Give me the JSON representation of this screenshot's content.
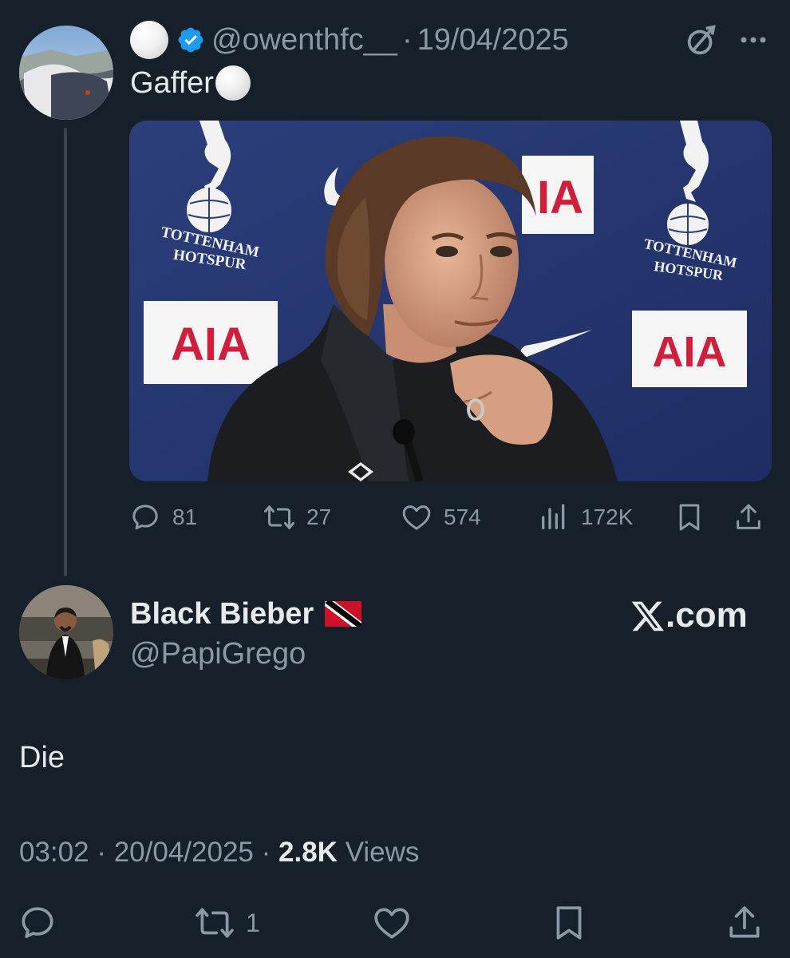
{
  "parent_tweet": {
    "name_icon": "white-circle-emoji",
    "verified_icon": "verified-badge-icon",
    "handle": "@owenthfc__",
    "separator": "·",
    "date": "19/04/2025",
    "text": "Gaffer",
    "text_emoji": "white-circle-emoji",
    "media": {
      "signage": {
        "club_line1": "TOTTENHAM",
        "club_line2": "HOTSPUR",
        "sponsor": "AIA",
        "sponsor_partial": "IA"
      }
    },
    "actions": {
      "replies": "81",
      "reposts": "27",
      "likes": "574",
      "views": "172K"
    }
  },
  "reply_tweet": {
    "display_name": "Black Bieber",
    "flag": "trinidad-and-tobago-flag",
    "handle": "@PapiGrego",
    "watermark": ".com",
    "text": "Die",
    "meta": {
      "time": "03:02",
      "sep1": "·",
      "date": "20/04/2025",
      "sep2": "·",
      "views_count": "2.8K",
      "views_label": "Views"
    },
    "actions": {
      "reposts": "1"
    }
  },
  "colors": {
    "background": "#15202b",
    "text_primary": "#e7e9ea",
    "text_secondary": "#8b98a5",
    "verified_blue": "#1d9bf0",
    "thread_line": "#38444d"
  }
}
